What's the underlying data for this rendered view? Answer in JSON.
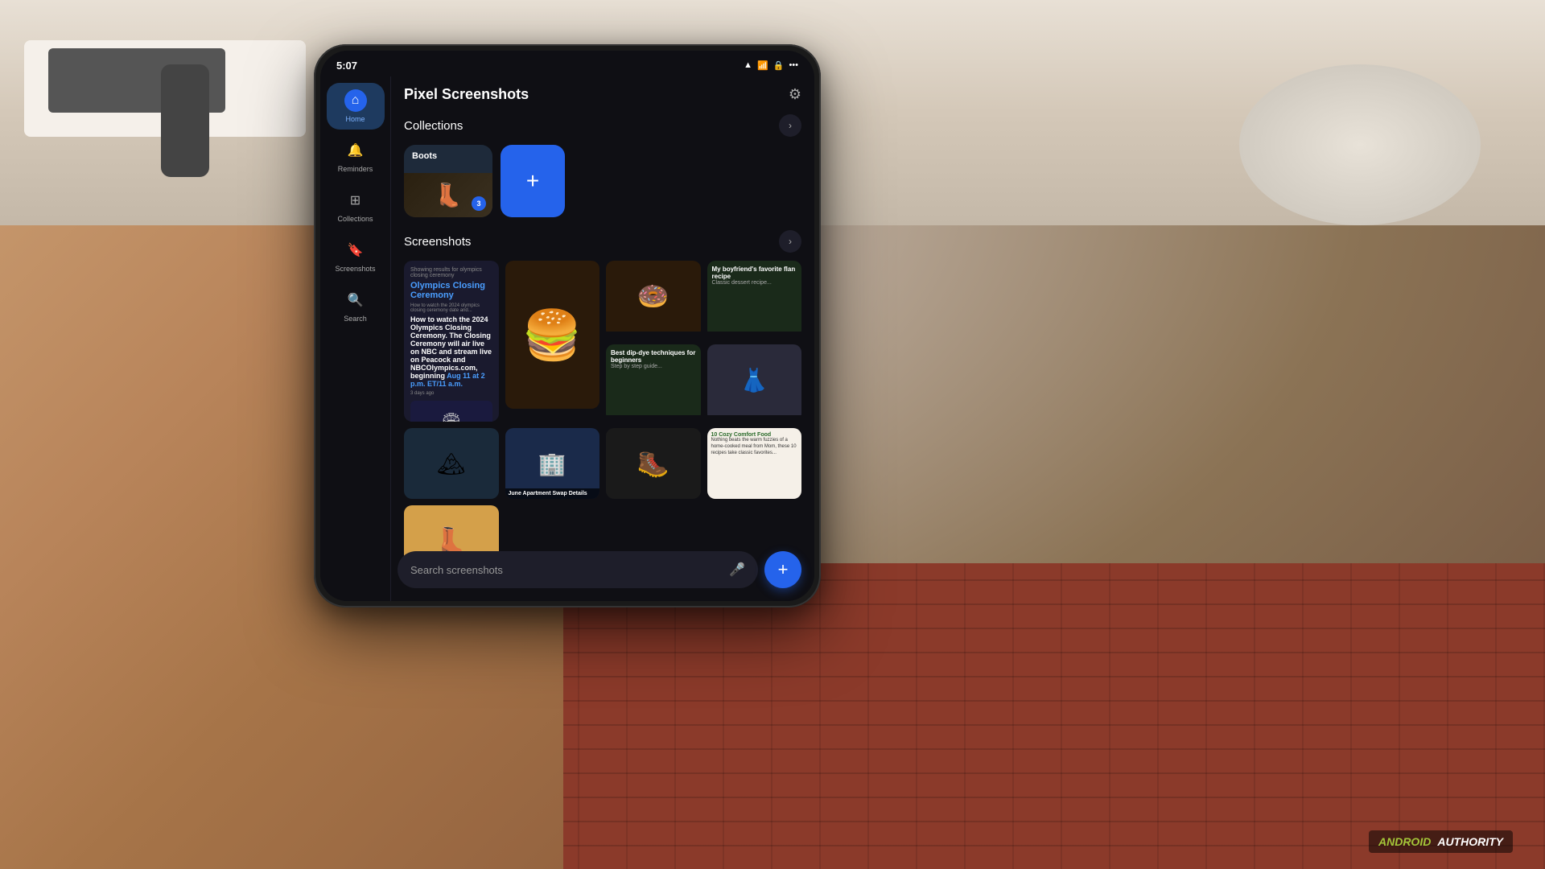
{
  "background": {
    "table_color": "#d4c8b8",
    "floor_color": "#8b3a2a",
    "hand_color": "#b8845a"
  },
  "phone": {
    "status_bar": {
      "time": "5:07",
      "wifi_icon": "wifi",
      "signal_icon": "signal",
      "battery_icon": "battery"
    },
    "app": {
      "title": "Pixel Screenshots",
      "settings_icon": "⚙"
    },
    "sidebar": {
      "items": [
        {
          "id": "home",
          "label": "Home",
          "icon": "⌂",
          "active": true
        },
        {
          "id": "reminders",
          "label": "Reminders",
          "icon": "🔔",
          "active": false
        },
        {
          "id": "collections",
          "label": "Collections",
          "icon": "⊞",
          "active": false
        },
        {
          "id": "screenshots",
          "label": "Screenshots",
          "icon": "🔖",
          "active": false
        },
        {
          "id": "search",
          "label": "Search",
          "icon": "🔍",
          "active": false
        }
      ]
    },
    "collections_section": {
      "title": "Collections",
      "arrow": ">",
      "items": [
        {
          "id": "boots",
          "label": "Boots",
          "badge": "3",
          "thumb_emoji": "👢"
        }
      ],
      "add_label": "+"
    },
    "screenshots_section": {
      "title": "Screenshots",
      "arrow": ">",
      "items": [
        {
          "id": "olympics",
          "type": "text",
          "title": "Olympics Closing Ceremony",
          "subtitle": "How to watch the 2024 Olympics Closing Ceremony...",
          "highlight": "Aug 11 at 2 p.m. ET/11 a.m.",
          "time": "3 days ago"
        },
        {
          "id": "donuts",
          "type": "image",
          "emoji": "🍩"
        },
        {
          "id": "recipe-card",
          "type": "text",
          "title": "My boyfriend's favorite flan recipe",
          "size": "small"
        },
        {
          "id": "dip-recipe",
          "type": "text",
          "title": "Best dip-dye techniques for beginners",
          "size": "small"
        },
        {
          "id": "burger",
          "type": "image",
          "emoji": "🍔"
        },
        {
          "id": "fashion",
          "type": "image",
          "emoji": "👗"
        },
        {
          "id": "nature",
          "type": "image",
          "emoji": "🏔"
        },
        {
          "id": "apartment",
          "type": "image",
          "emoji": "🏢",
          "caption": "June Apartment Swap Details"
        },
        {
          "id": "black-boots",
          "type": "image",
          "emoji": "🥾"
        },
        {
          "id": "comfort-food",
          "type": "text",
          "title": "10 Cozy Comfort Food",
          "size": "small"
        },
        {
          "id": "cowboy-boots",
          "type": "image",
          "emoji": "👢"
        }
      ]
    },
    "search_bar": {
      "placeholder": "Search screenshots",
      "mic_icon": "🎤",
      "add_icon": "+"
    }
  },
  "watermark": {
    "android_text": "ANDROID",
    "authority_text": "AUTHORITY"
  }
}
